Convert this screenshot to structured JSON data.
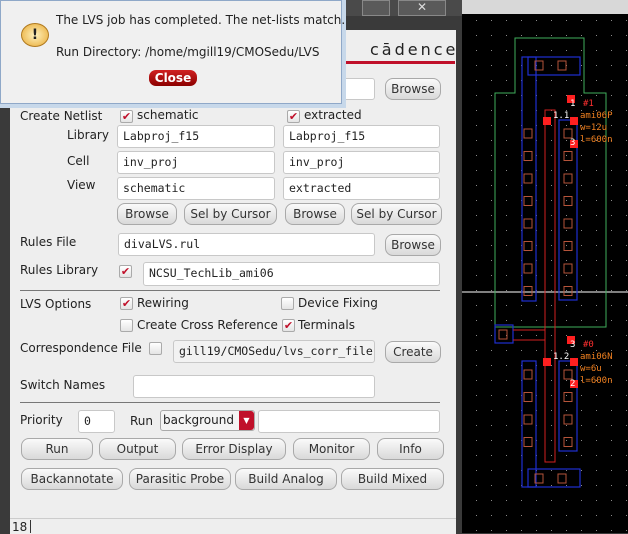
{
  "dialog": {
    "message": "The LVS job has completed. The net-lists match.",
    "run_directory": "Run Directory: /home/mgill19/CMOSedu/LVS",
    "close_label": "Close",
    "icon": "warning-speech-bubble-icon"
  },
  "form": {
    "brand": "cādence",
    "create_netlist": {
      "label": "Create Netlist",
      "schematic": {
        "label": "schematic",
        "checked": true
      },
      "extracted": {
        "label": "extracted",
        "checked": true
      }
    },
    "library": {
      "label": "Library",
      "schematic": "Labproj_f15",
      "extracted": "Labproj_f15"
    },
    "cell": {
      "label": "Cell",
      "schematic": "inv_proj",
      "extracted": "inv_proj"
    },
    "view": {
      "label": "View",
      "schematic": "schematic",
      "extracted": "extracted"
    },
    "browse_label": "Browse",
    "sel_by_cursor_label": "Sel by Cursor",
    "rules_file": {
      "label": "Rules File",
      "value": "divaLVS.rul"
    },
    "rules_library": {
      "label": "Rules Library",
      "checked": true,
      "value": "NCSU_TechLib_ami06"
    },
    "lvs_options": {
      "label": "LVS Options",
      "rewiring": {
        "label": "Rewiring",
        "checked": true
      },
      "device_fixing": {
        "label": "Device Fixing",
        "checked": false
      },
      "cross_reference": {
        "label": "Create Cross Reference",
        "checked": false
      },
      "terminals": {
        "label": "Terminals",
        "checked": true
      }
    },
    "correspondence": {
      "label": "Correspondence File",
      "checked": false,
      "value": "gill19/CMOSedu/lvs_corr_file",
      "create_label": "Create"
    },
    "switch_names": {
      "label": "Switch Names",
      "value": ""
    },
    "priority": {
      "label": "Priority",
      "value": "0"
    },
    "run": {
      "label": "Run",
      "mode": "background",
      "extra": ""
    },
    "buttons_row1": [
      "Run",
      "Output",
      "Error Display",
      "Monitor",
      "Info"
    ],
    "buttons_row2": [
      "Backannotate",
      "Parasitic Probe",
      "Build Analog",
      "Build Mixed"
    ],
    "status_line": "18"
  },
  "layout": {
    "pmos": {
      "pin": "#1",
      "model": "ami06P",
      "w": "w=12u",
      "l": "l=600n",
      "t1": "1",
      "t2": "3",
      "inst": "1.1"
    },
    "nmos": {
      "pin": "#0",
      "model": "ami06N",
      "w": "w=6u",
      "l": "l=600n",
      "t1": "3",
      "t2": "2",
      "inst": "1.2"
    }
  },
  "colors": {
    "accent": "#c0102a",
    "nwell": "#3fae5b",
    "metal": "#1f2fd0",
    "poly": "#d02020",
    "label": "#f08020"
  }
}
